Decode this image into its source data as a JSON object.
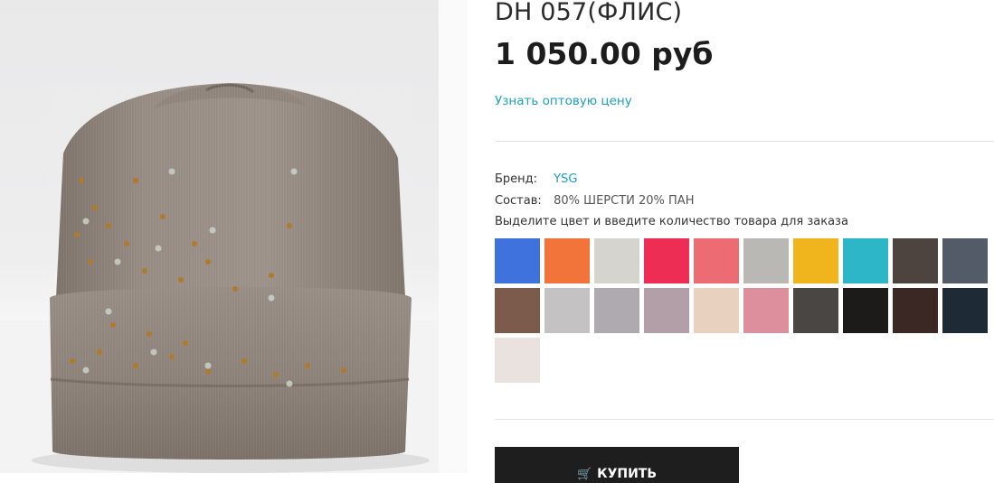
{
  "product": {
    "title": "DH 057(ФЛИС)",
    "price": "1 050.00 руб",
    "wholesale_link": "Узнать оптовую цену",
    "image_alt": "Вязаная шапка с отворотом и стразами"
  },
  "specs": {
    "brand_label": "Бренд:",
    "brand_value": "YSG",
    "composition_label": "Состав:",
    "composition_value": "80% ШЕРСТИ 20% ПАН"
  },
  "colors": {
    "instruction": "Выделите цвет и введите количество товара для заказа",
    "swatches": [
      {
        "name": "swatch-blue",
        "hex": "#3f72dc"
      },
      {
        "name": "swatch-orange",
        "hex": "#f2743a"
      },
      {
        "name": "swatch-light-grey",
        "hex": "#d6d4cf"
      },
      {
        "name": "swatch-raspberry",
        "hex": "#ee2d55"
      },
      {
        "name": "swatch-coral",
        "hex": "#ed6b72"
      },
      {
        "name": "swatch-grey-melange",
        "hex": "#b9b8b4"
      },
      {
        "name": "swatch-mustard",
        "hex": "#f0b41c"
      },
      {
        "name": "swatch-turquoise",
        "hex": "#2cb6c8"
      },
      {
        "name": "swatch-dark-brown",
        "hex": "#4d433f"
      },
      {
        "name": "swatch-slate",
        "hex": "#535b68"
      },
      {
        "name": "swatch-brown",
        "hex": "#7c5a4c"
      },
      {
        "name": "swatch-silver",
        "hex": "#c4c2c3"
      },
      {
        "name": "swatch-grey",
        "hex": "#aeaab0"
      },
      {
        "name": "swatch-mauve",
        "hex": "#b29fa8"
      },
      {
        "name": "swatch-beige",
        "hex": "#e8d2bf"
      },
      {
        "name": "swatch-pink",
        "hex": "#de8f9e"
      },
      {
        "name": "swatch-graphite",
        "hex": "#4a4644"
      },
      {
        "name": "swatch-black",
        "hex": "#1d1a1a"
      },
      {
        "name": "swatch-chocolate",
        "hex": "#3b2723"
      },
      {
        "name": "swatch-navy",
        "hex": "#1e2a35"
      },
      {
        "name": "swatch-white",
        "hex": "#e9e2df"
      }
    ]
  },
  "actions": {
    "buy_label": "КУПИТЬ",
    "buy_icon": "cart-icon"
  }
}
